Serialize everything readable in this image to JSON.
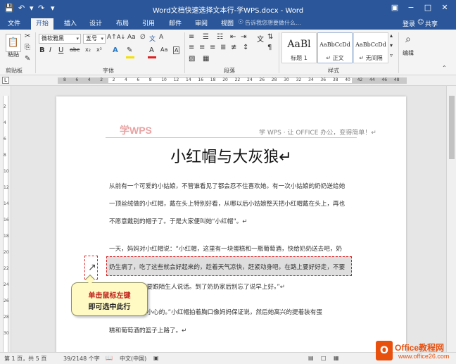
{
  "window": {
    "title": "Word文档快速选择文本行-学WPS.docx - Word"
  },
  "quick_access": {
    "save_icon": "save-icon",
    "undo_icon": "undo-icon",
    "redo_icon": "redo-icon",
    "customize_icon": "dropdown-icon"
  },
  "tabs": [
    "文件",
    "开始",
    "插入",
    "设计",
    "布局",
    "引用",
    "邮件",
    "审阅",
    "视图"
  ],
  "active_tab": "开始",
  "tell_me": "告诉我您想要做什么...",
  "signin": "登录",
  "share": "共享",
  "ribbon": {
    "clipboard": {
      "label": "剪贴板",
      "paste": "粘贴"
    },
    "font": {
      "label": "字体",
      "font_name": "微软雅黑",
      "font_size": "五号",
      "font_color": "#e02020",
      "highlight_color": "#f5e100",
      "buttons": [
        "B",
        "I",
        "U",
        "abc",
        "x₂",
        "x²",
        "A",
        "A",
        "Aa",
        "A"
      ]
    },
    "paragraph": {
      "label": "段落"
    },
    "styles": {
      "label": "样式",
      "items": [
        {
          "sample": "AaBl",
          "name": "标题 1"
        },
        {
          "sample": "AaBbCcDd",
          "name": "↵ 正文"
        },
        {
          "sample": "AaBbCcDd",
          "name": "↵ 无间隔"
        }
      ]
    },
    "editing": {
      "label": "编辑"
    }
  },
  "ruler": {
    "ticks": [
      "8",
      "6",
      "4",
      "2",
      "2",
      "4",
      "6",
      "8",
      "10",
      "12",
      "14",
      "16",
      "18",
      "20",
      "22",
      "24",
      "26",
      "28",
      "30",
      "32",
      "34",
      "36",
      "38",
      "40",
      "42",
      "44",
      "46",
      "48"
    ]
  },
  "vruler": {
    "ticks": [
      "2",
      "4",
      "6",
      "8",
      "10",
      "12",
      "14",
      "16",
      "18",
      "20",
      "22",
      "24",
      "26",
      "28",
      "30"
    ]
  },
  "document": {
    "header_logo": "学WPS",
    "header_tagline": "学 WPS · 让 OFFICE 办公，变得简单！↵",
    "title": "小红帽与大灰狼↵",
    "lines": [
      "从前有一个可爱的小姑娘，不管谁看见了都会忍不住喜欢她。有一次小姑娘的奶奶送给她",
      "一顶丝绒做的小红帽，戴在头上特别好看，从哪以后小姑娘整天把小红帽戴在头上，再也",
      "不愿意戴别的帽子了。于是大家便叫她“小红帽”。↵",
      "一天，妈妈对小红帽说：“小红帽，这里有一块蛋糕和一瓶葡萄酒，快给奶奶送去吧，奶",
      "奶生病了，吃了这些就会好起来的，趁着天气凉快，赶紧动身吧，在路上要好好走，不要",
      "不要跟陌生人说话。到了奶奶家后别忘了说早上好。”↵",
      "会小心的。”小红帽拍着胸口像妈妈保证说，然后她高兴的提着装有蛋",
      "糕和葡萄酒的篮子上路了。↵"
    ]
  },
  "callout": {
    "line1": "单击鼠标左键",
    "line2": "即可选中此行"
  },
  "statusbar": {
    "page": "第 1 页，共 5 页",
    "words": "39/2148 个字",
    "language": "中文(中国)"
  },
  "watermark": {
    "icon_text": "O",
    "name": "Office教程网",
    "url": "www.office26.com"
  }
}
